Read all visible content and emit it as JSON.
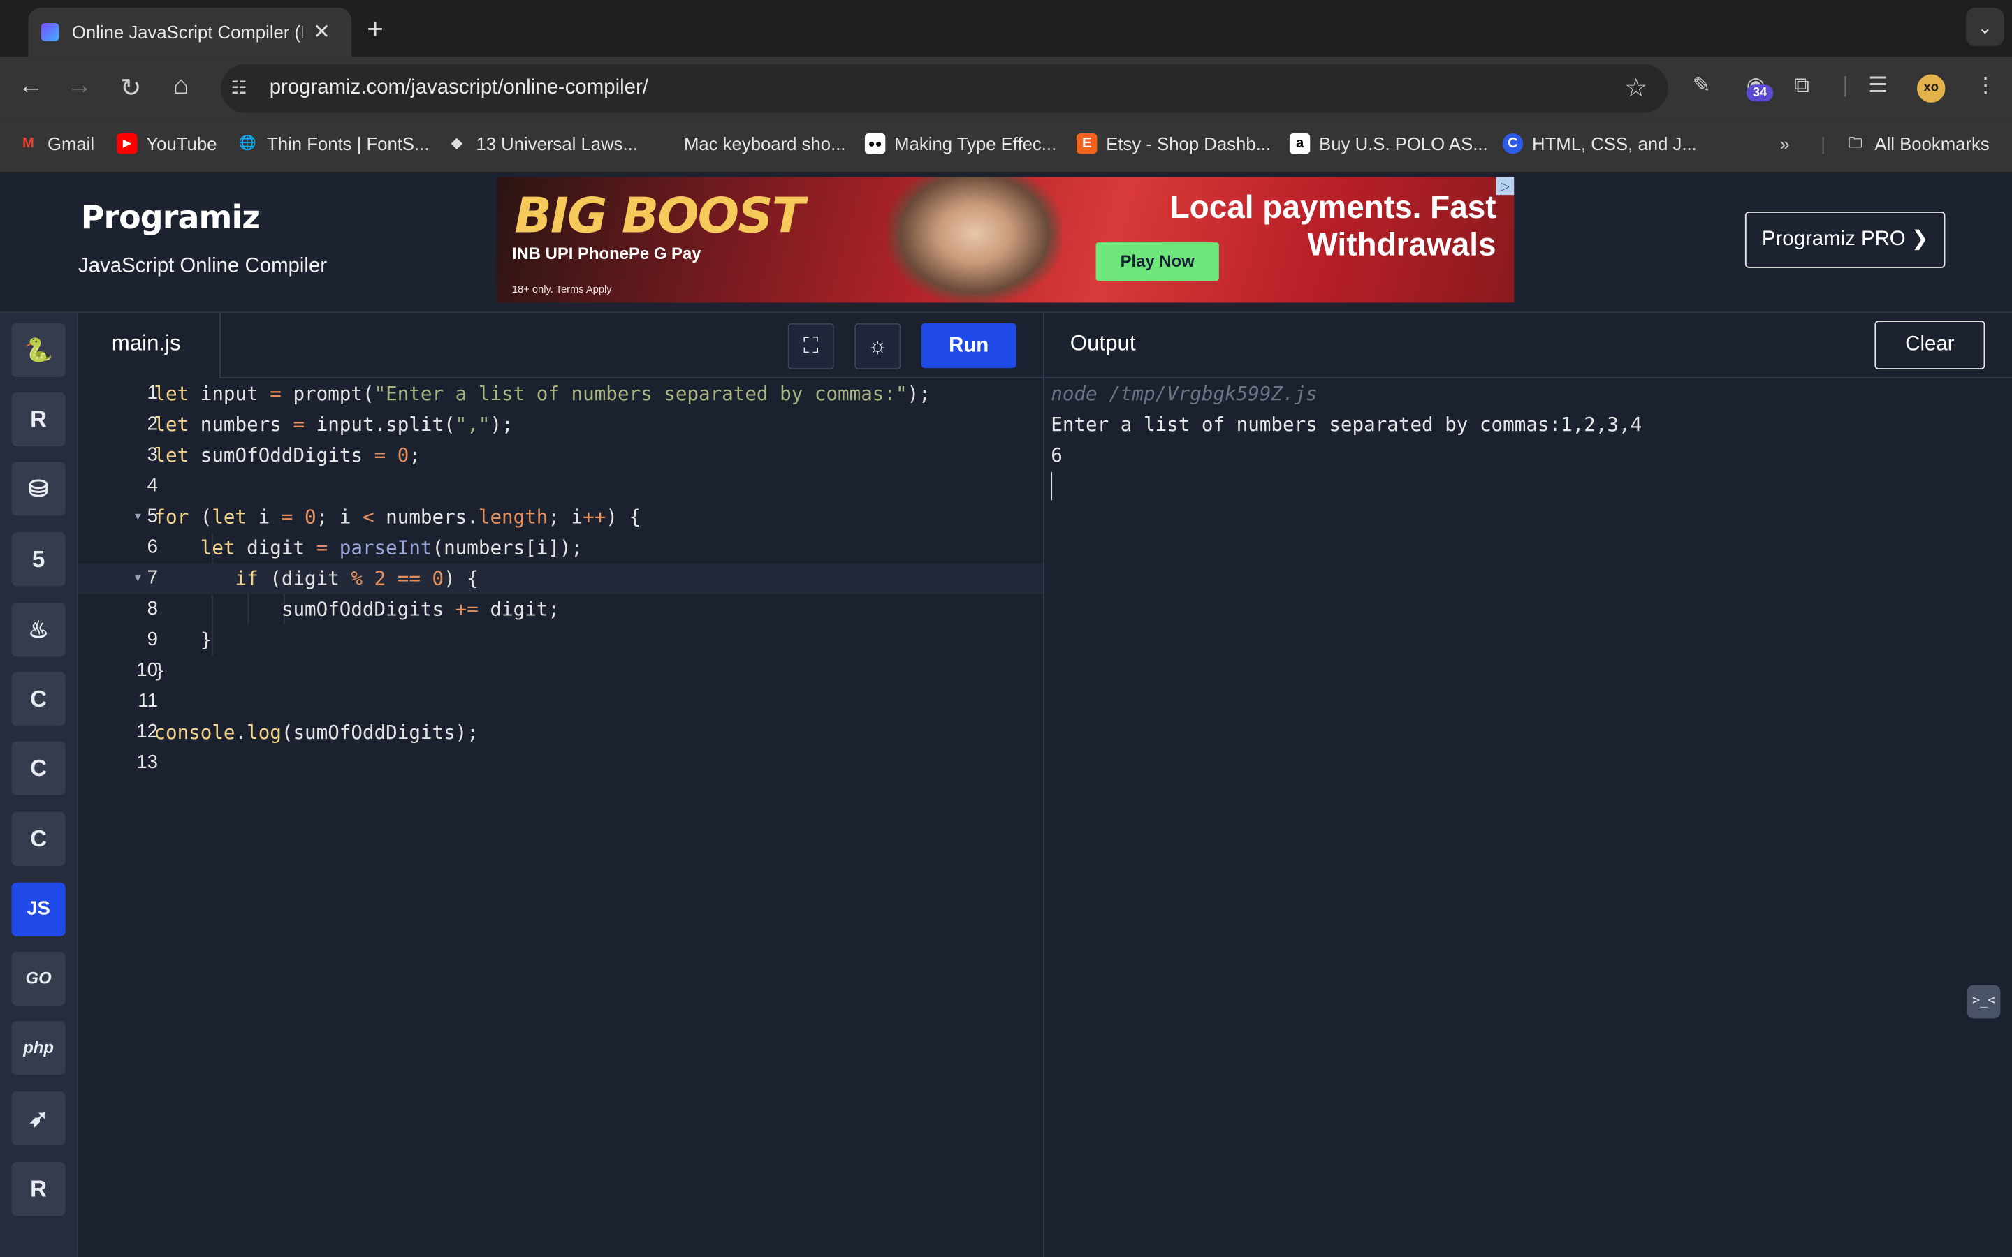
{
  "browser": {
    "tab_title": "Online JavaScript Compiler (E",
    "new_tab": "+",
    "url": "programiz.com/javascript/online-compiler/",
    "extension_badge": "34",
    "bookmarks": [
      {
        "label": "Gmail"
      },
      {
        "label": "YouTube"
      },
      {
        "label": "Thin Fonts | FontS..."
      },
      {
        "label": "13 Universal Laws..."
      },
      {
        "label": "Mac keyboard sho..."
      },
      {
        "label": "Making Type Effec..."
      },
      {
        "label": "Etsy - Shop Dashb..."
      },
      {
        "label": "Buy U.S. POLO AS..."
      },
      {
        "label": "HTML, CSS, and J..."
      }
    ],
    "all_bookmarks": "All Bookmarks"
  },
  "site": {
    "logo": "Programiz",
    "subtitle": "JavaScript Online Compiler",
    "pro_button": "Programiz PRO ❯"
  },
  "ad": {
    "brand": "BIG BOOST",
    "payments": "INB   UPI   PhonePe   G Pay",
    "fine_print": "18+ only. Terms Apply",
    "headline_1": "Local payments. Fast",
    "headline_2": "Withdrawals",
    "cta": "Play Now"
  },
  "sidebar": {
    "languages": [
      {
        "name": "python-icon",
        "glyph": "🐍"
      },
      {
        "name": "r-icon",
        "glyph": "R"
      },
      {
        "name": "sql-icon",
        "glyph": "⛁"
      },
      {
        "name": "html-icon",
        "glyph": "5"
      },
      {
        "name": "java-icon",
        "glyph": "♨"
      },
      {
        "name": "c-icon",
        "glyph": "C"
      },
      {
        "name": "cpp-icon",
        "glyph": "C"
      },
      {
        "name": "csharp-icon",
        "glyph": "C"
      },
      {
        "name": "js-icon",
        "glyph": "JS"
      },
      {
        "name": "go-icon",
        "glyph": "GO"
      },
      {
        "name": "php-icon",
        "glyph": "php"
      },
      {
        "name": "swift-icon",
        "glyph": "➶"
      },
      {
        "name": "rust-icon",
        "glyph": "R"
      }
    ]
  },
  "editor": {
    "filename": "main.js",
    "run_label": "Run",
    "line_numbers": [
      "1",
      "2",
      "3",
      "4",
      "5",
      "6",
      "7",
      "8",
      "9",
      "10",
      "11",
      "12",
      "13"
    ]
  },
  "output": {
    "title": "Output",
    "clear_label": "Clear",
    "command": "node /tmp/Vrgbgk599Z.js",
    "lines": [
      "Enter a list of numbers separated by commas:1,2,3,4",
      "6"
    ]
  }
}
